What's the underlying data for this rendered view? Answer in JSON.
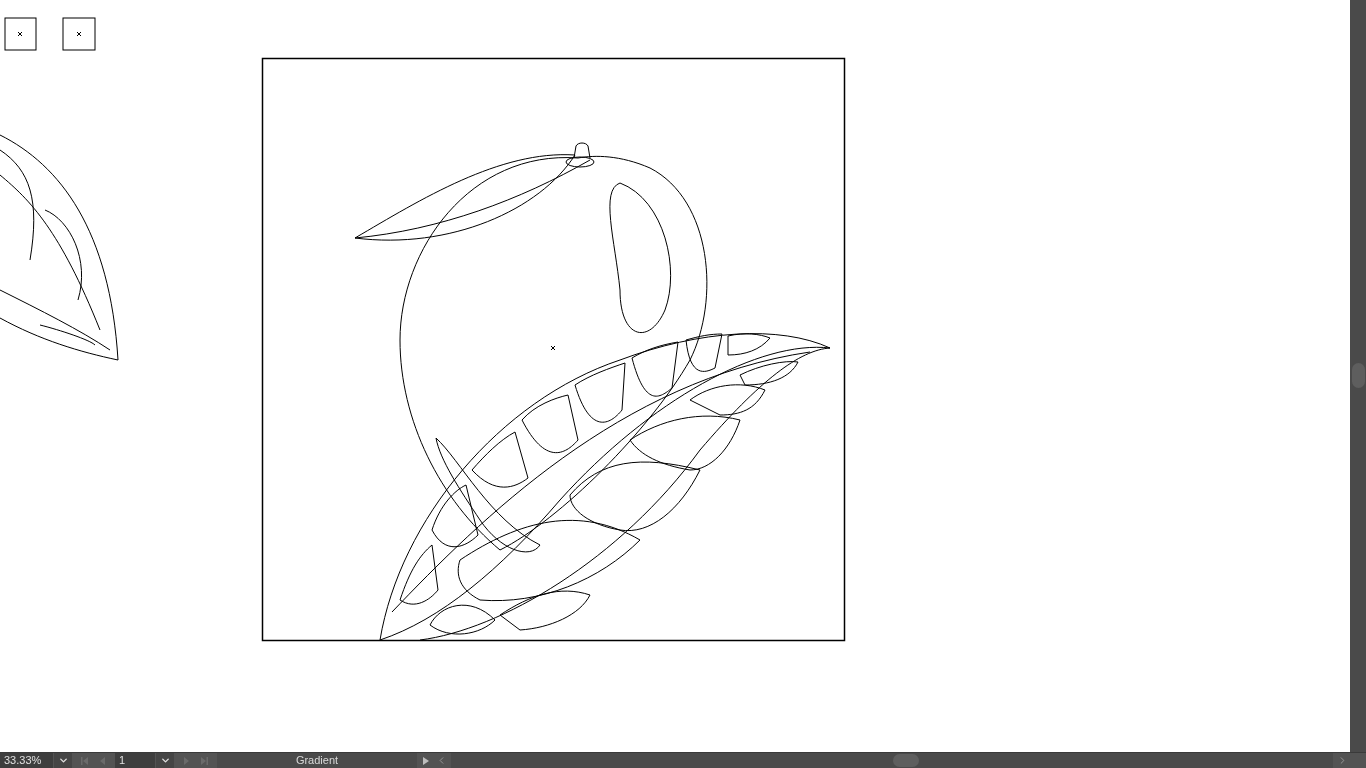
{
  "status_bar": {
    "zoom": "33.33%",
    "artboard": "1",
    "status_text": "Gradient"
  }
}
